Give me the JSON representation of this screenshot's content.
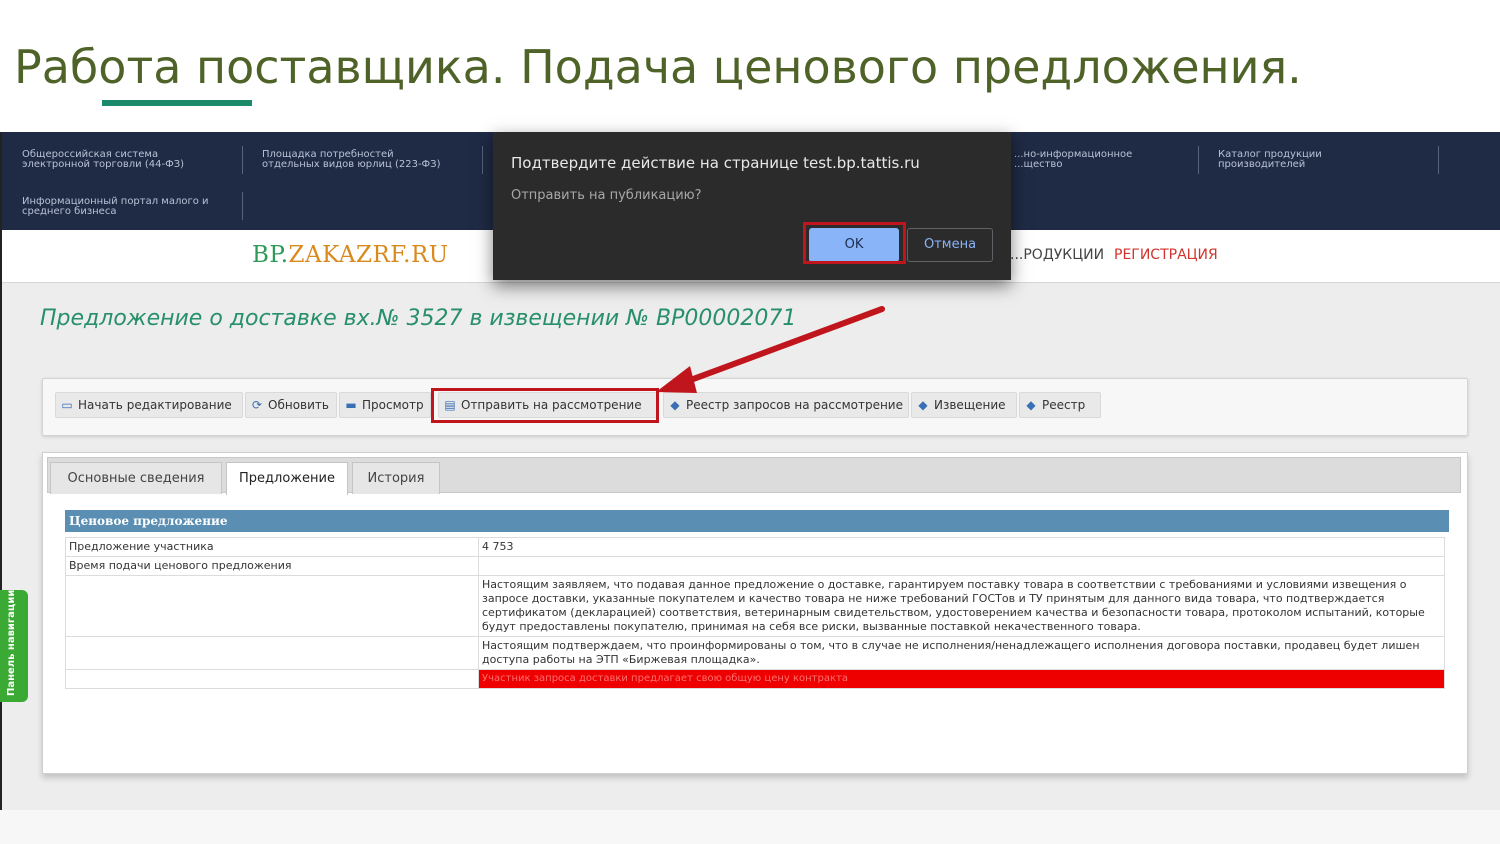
{
  "slide": {
    "title": "Работа поставщика. Подача ценового предложения."
  },
  "topnav": {
    "links": [
      "Общероссийская система\nэлектронной торговли (44-ФЗ)",
      "Площадка потребностей\nотдельных видов юрлиц (223-ФЗ)",
      "Информационный портал малого и\nсреднего бизнеса",
      "...но-информационное\n...щество",
      "Каталог продукции\nпроизводителей"
    ]
  },
  "site": {
    "logo_bp": "BP.",
    "logo_rest": "ZAKAZRF.RU",
    "menu_products": "...РОДУКЦИИ",
    "menu_registration": "РЕГИСТРАЦИЯ"
  },
  "page": {
    "heading": "Предложение о доставке вх.№ 3527 в извещении № BP00002071"
  },
  "toolbar": {
    "buttons": [
      {
        "label": "Начать редактирование",
        "icon": "edit-icon"
      },
      {
        "label": "Обновить",
        "icon": "refresh-icon"
      },
      {
        "label": "Просмотр",
        "icon": "print-preview-icon"
      },
      {
        "label": "Отправить на рассмотрение",
        "icon": "send-icon"
      },
      {
        "label": "Реестр запросов на рассмотрение",
        "icon": "arrow-left-icon"
      },
      {
        "label": "Извещение",
        "icon": "arrow-left-icon"
      },
      {
        "label": "Реестр",
        "icon": "arrow-left-icon"
      }
    ]
  },
  "tabs": [
    "Основные сведения",
    "Предложение",
    "История"
  ],
  "price_section": {
    "title": "Ценовое предложение",
    "rows": [
      {
        "label": "Предложение участника",
        "value": "4 753"
      },
      {
        "label": "Время подачи ценового предложения",
        "value": ""
      },
      {
        "label": "",
        "value": "Настоящим заявляем, что подавая данное предложение о доставке, гарантируем поставку товара в соответствии с требованиями и условиями извещения о запросе доставки, указанные покупателем и качество товара не ниже требований ГОСТов и ТУ принятым для данного вида товара, что подтверждается сертификатом (декларацией) соответствия, ветеринарным свидетельством, удостоверением качества и безопасности товара, протоколом испытаний, которые будут предоставлены покупателю, принимая на себя все риски, вызванные поставкой некачественного товара."
      },
      {
        "label": "",
        "value": "Настоящим подтверждаем, что проинформированы о том, что в случае не исполнения/ненадлежащего исполнения договора поставки, продавец будет лишен доступа работы на ЭТП «Биржевая площадка»."
      },
      {
        "label": "",
        "value": "Участник запроса доставки предлагает свою общую цену контракта"
      }
    ]
  },
  "side_panel": {
    "label": "Панель навигации"
  },
  "dialog": {
    "title": "Подтвердите действие на странице test.bp.tattis.ru",
    "message": "Отправить на публикацию?",
    "ok_label": "OK",
    "cancel_label": "Отмена"
  },
  "colors": {
    "title_text": "#4f6228",
    "underline": "#1a8a6a",
    "nav_bg": "#1f2a44",
    "heading_green": "#27906a",
    "highlight_red": "#c0151c",
    "section_head": "#5a8fb3",
    "warning_red": "#ee0000"
  }
}
